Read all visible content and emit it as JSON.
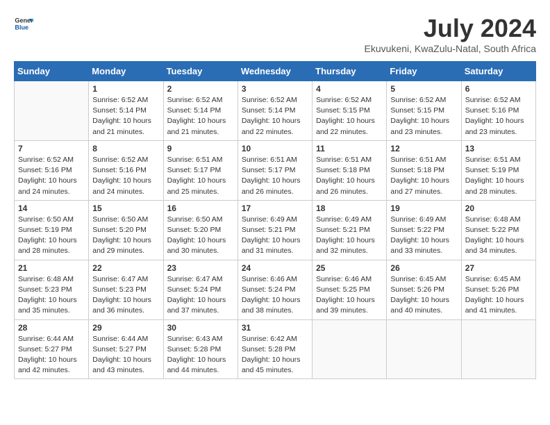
{
  "logo": {
    "general": "General",
    "blue": "Blue"
  },
  "title": "July 2024",
  "subtitle": "Ekuvukeni, KwaZulu-Natal, South Africa",
  "days_of_week": [
    "Sunday",
    "Monday",
    "Tuesday",
    "Wednesday",
    "Thursday",
    "Friday",
    "Saturday"
  ],
  "weeks": [
    [
      {
        "day": "",
        "sunrise": "",
        "sunset": "",
        "daylight": ""
      },
      {
        "day": "1",
        "sunrise": "6:52 AM",
        "sunset": "5:14 PM",
        "daylight": "10 hours and 21 minutes."
      },
      {
        "day": "2",
        "sunrise": "6:52 AM",
        "sunset": "5:14 PM",
        "daylight": "10 hours and 21 minutes."
      },
      {
        "day": "3",
        "sunrise": "6:52 AM",
        "sunset": "5:14 PM",
        "daylight": "10 hours and 22 minutes."
      },
      {
        "day": "4",
        "sunrise": "6:52 AM",
        "sunset": "5:15 PM",
        "daylight": "10 hours and 22 minutes."
      },
      {
        "day": "5",
        "sunrise": "6:52 AM",
        "sunset": "5:15 PM",
        "daylight": "10 hours and 23 minutes."
      },
      {
        "day": "6",
        "sunrise": "6:52 AM",
        "sunset": "5:16 PM",
        "daylight": "10 hours and 23 minutes."
      }
    ],
    [
      {
        "day": "7",
        "sunrise": "6:52 AM",
        "sunset": "5:16 PM",
        "daylight": "10 hours and 24 minutes."
      },
      {
        "day": "8",
        "sunrise": "6:52 AM",
        "sunset": "5:16 PM",
        "daylight": "10 hours and 24 minutes."
      },
      {
        "day": "9",
        "sunrise": "6:51 AM",
        "sunset": "5:17 PM",
        "daylight": "10 hours and 25 minutes."
      },
      {
        "day": "10",
        "sunrise": "6:51 AM",
        "sunset": "5:17 PM",
        "daylight": "10 hours and 26 minutes."
      },
      {
        "day": "11",
        "sunrise": "6:51 AM",
        "sunset": "5:18 PM",
        "daylight": "10 hours and 26 minutes."
      },
      {
        "day": "12",
        "sunrise": "6:51 AM",
        "sunset": "5:18 PM",
        "daylight": "10 hours and 27 minutes."
      },
      {
        "day": "13",
        "sunrise": "6:51 AM",
        "sunset": "5:19 PM",
        "daylight": "10 hours and 28 minutes."
      }
    ],
    [
      {
        "day": "14",
        "sunrise": "6:50 AM",
        "sunset": "5:19 PM",
        "daylight": "10 hours and 28 minutes."
      },
      {
        "day": "15",
        "sunrise": "6:50 AM",
        "sunset": "5:20 PM",
        "daylight": "10 hours and 29 minutes."
      },
      {
        "day": "16",
        "sunrise": "6:50 AM",
        "sunset": "5:20 PM",
        "daylight": "10 hours and 30 minutes."
      },
      {
        "day": "17",
        "sunrise": "6:49 AM",
        "sunset": "5:21 PM",
        "daylight": "10 hours and 31 minutes."
      },
      {
        "day": "18",
        "sunrise": "6:49 AM",
        "sunset": "5:21 PM",
        "daylight": "10 hours and 32 minutes."
      },
      {
        "day": "19",
        "sunrise": "6:49 AM",
        "sunset": "5:22 PM",
        "daylight": "10 hours and 33 minutes."
      },
      {
        "day": "20",
        "sunrise": "6:48 AM",
        "sunset": "5:22 PM",
        "daylight": "10 hours and 34 minutes."
      }
    ],
    [
      {
        "day": "21",
        "sunrise": "6:48 AM",
        "sunset": "5:23 PM",
        "daylight": "10 hours and 35 minutes."
      },
      {
        "day": "22",
        "sunrise": "6:47 AM",
        "sunset": "5:23 PM",
        "daylight": "10 hours and 36 minutes."
      },
      {
        "day": "23",
        "sunrise": "6:47 AM",
        "sunset": "5:24 PM",
        "daylight": "10 hours and 37 minutes."
      },
      {
        "day": "24",
        "sunrise": "6:46 AM",
        "sunset": "5:24 PM",
        "daylight": "10 hours and 38 minutes."
      },
      {
        "day": "25",
        "sunrise": "6:46 AM",
        "sunset": "5:25 PM",
        "daylight": "10 hours and 39 minutes."
      },
      {
        "day": "26",
        "sunrise": "6:45 AM",
        "sunset": "5:26 PM",
        "daylight": "10 hours and 40 minutes."
      },
      {
        "day": "27",
        "sunrise": "6:45 AM",
        "sunset": "5:26 PM",
        "daylight": "10 hours and 41 minutes."
      }
    ],
    [
      {
        "day": "28",
        "sunrise": "6:44 AM",
        "sunset": "5:27 PM",
        "daylight": "10 hours and 42 minutes."
      },
      {
        "day": "29",
        "sunrise": "6:44 AM",
        "sunset": "5:27 PM",
        "daylight": "10 hours and 43 minutes."
      },
      {
        "day": "30",
        "sunrise": "6:43 AM",
        "sunset": "5:28 PM",
        "daylight": "10 hours and 44 minutes."
      },
      {
        "day": "31",
        "sunrise": "6:42 AM",
        "sunset": "5:28 PM",
        "daylight": "10 hours and 45 minutes."
      },
      {
        "day": "",
        "sunrise": "",
        "sunset": "",
        "daylight": ""
      },
      {
        "day": "",
        "sunrise": "",
        "sunset": "",
        "daylight": ""
      },
      {
        "day": "",
        "sunrise": "",
        "sunset": "",
        "daylight": ""
      }
    ]
  ]
}
